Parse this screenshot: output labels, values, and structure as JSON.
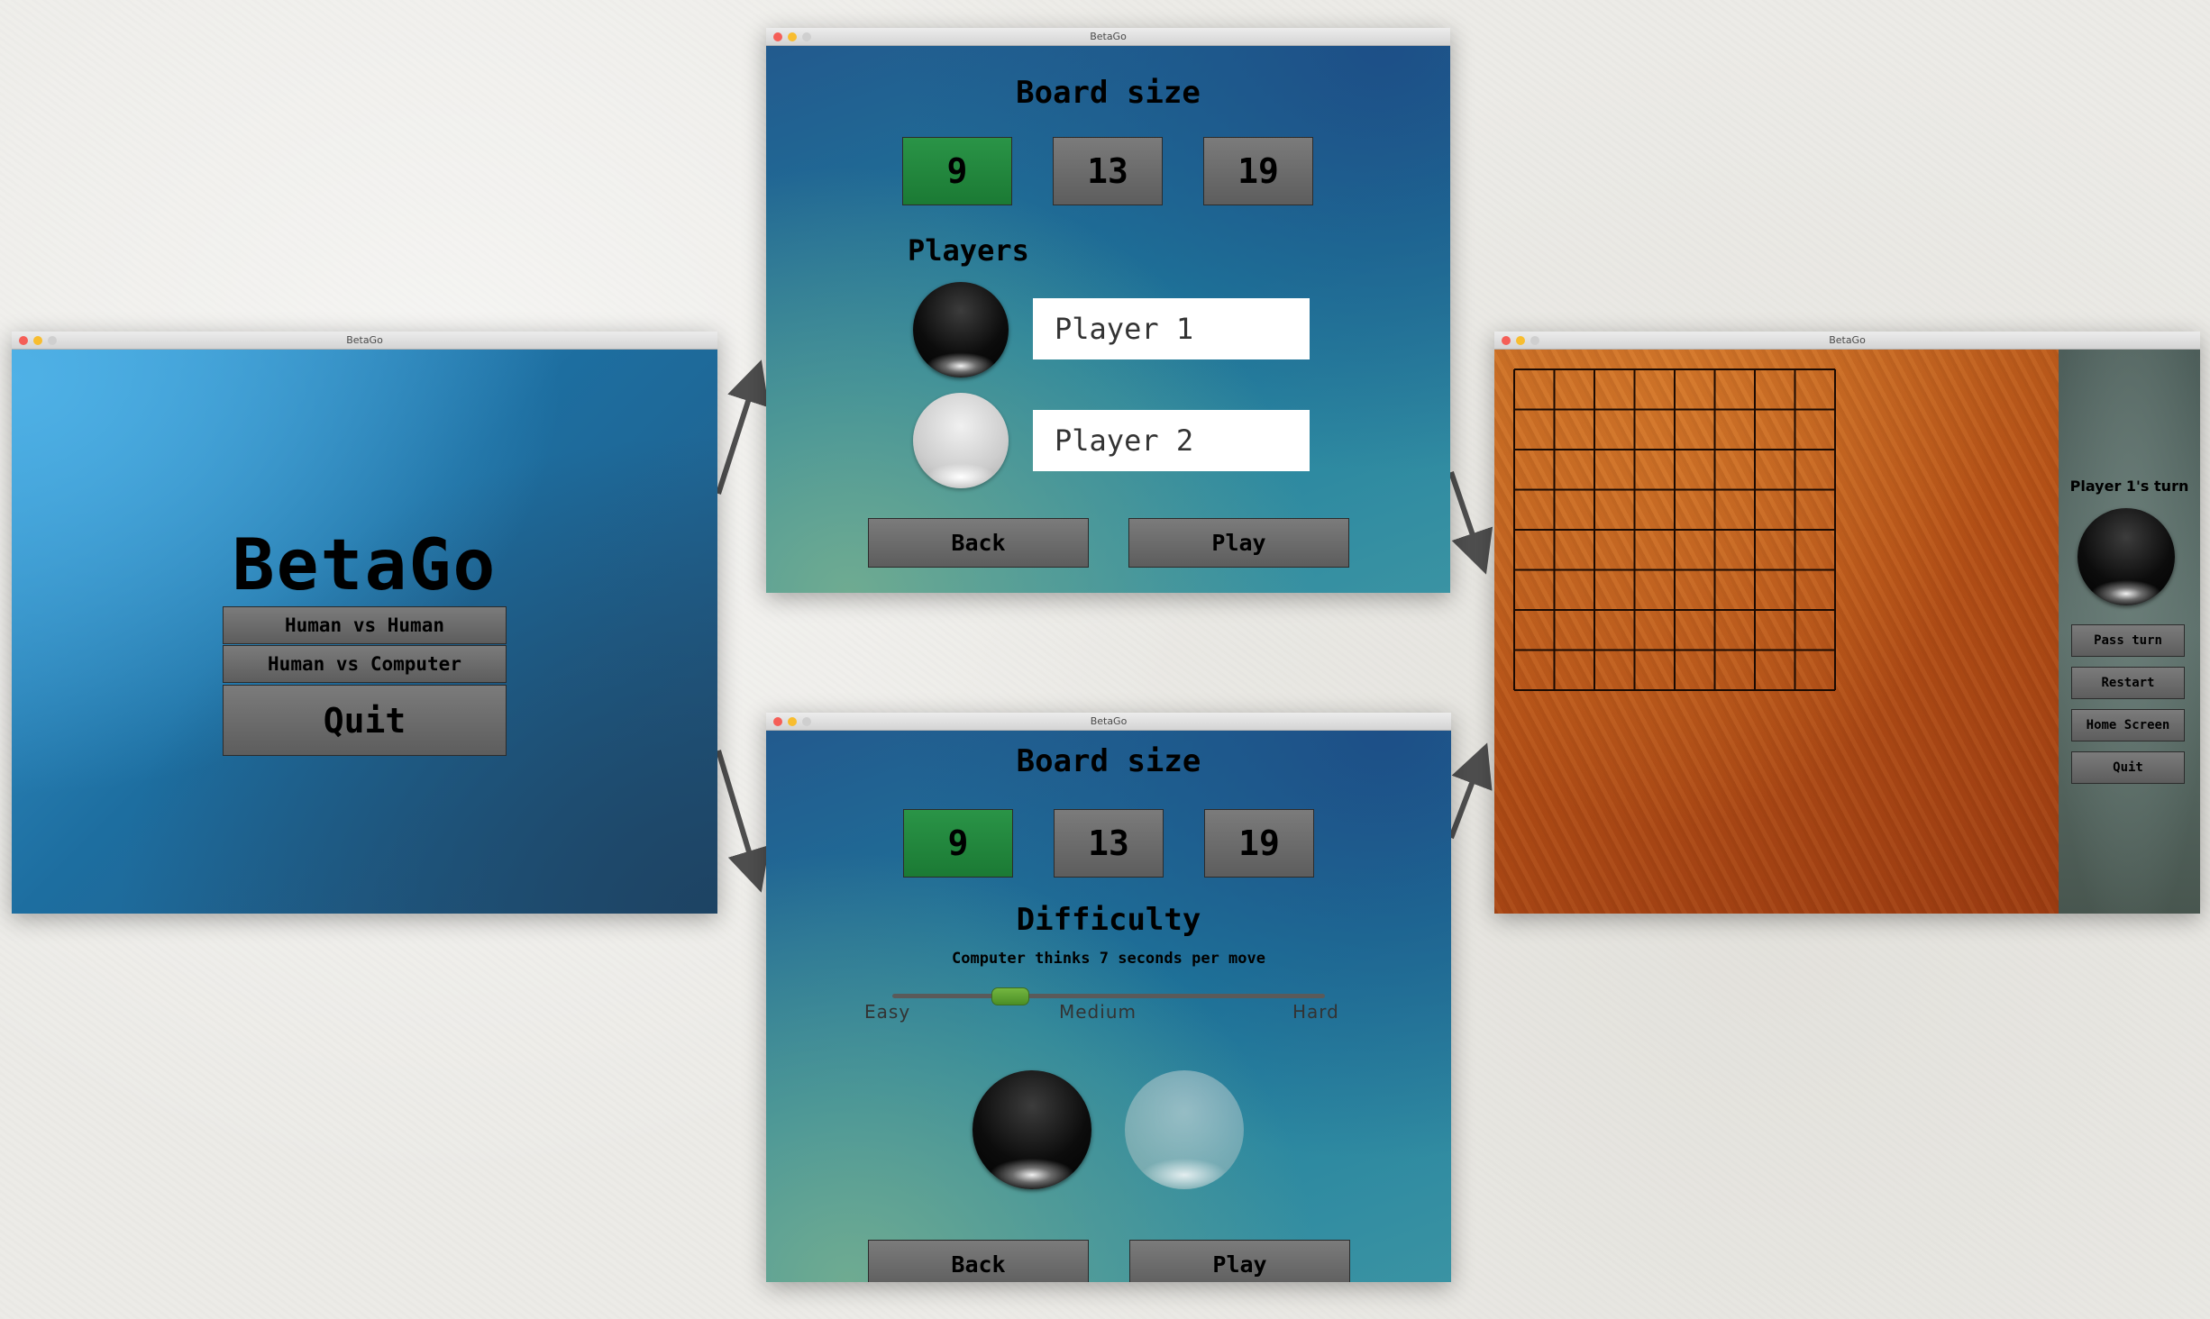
{
  "app_title": "BetaGo",
  "home": {
    "logo": "BetaGo",
    "buttons": [
      "Human vs Human",
      "Human vs Computer"
    ],
    "quit": "Quit"
  },
  "setup_hh": {
    "board_size_heading": "Board size",
    "sizes": [
      "9",
      "13",
      "19"
    ],
    "selected_size": "9",
    "players_heading": "Players",
    "player1_name": "Player 1",
    "player2_name": "Player 2",
    "back": "Back",
    "play": "Play"
  },
  "setup_hc": {
    "board_size_heading": "Board size",
    "sizes": [
      "9",
      "13",
      "19"
    ],
    "selected_size": "9",
    "difficulty_heading": "Difficulty",
    "difficulty_note": "Computer thinks 7 seconds per move",
    "slider_labels": [
      "Easy",
      "Medium",
      "Hard"
    ],
    "slider_value": 0.27,
    "back": "Back",
    "play": "Play"
  },
  "game": {
    "board_lines": 9,
    "turn_text": "Player 1's turn",
    "buttons": [
      "Pass turn",
      "Restart",
      "Home Screen",
      "Quit"
    ]
  },
  "colors": {
    "selected_green": "#1f8a3c",
    "button_gray": "#6b6b6b"
  }
}
